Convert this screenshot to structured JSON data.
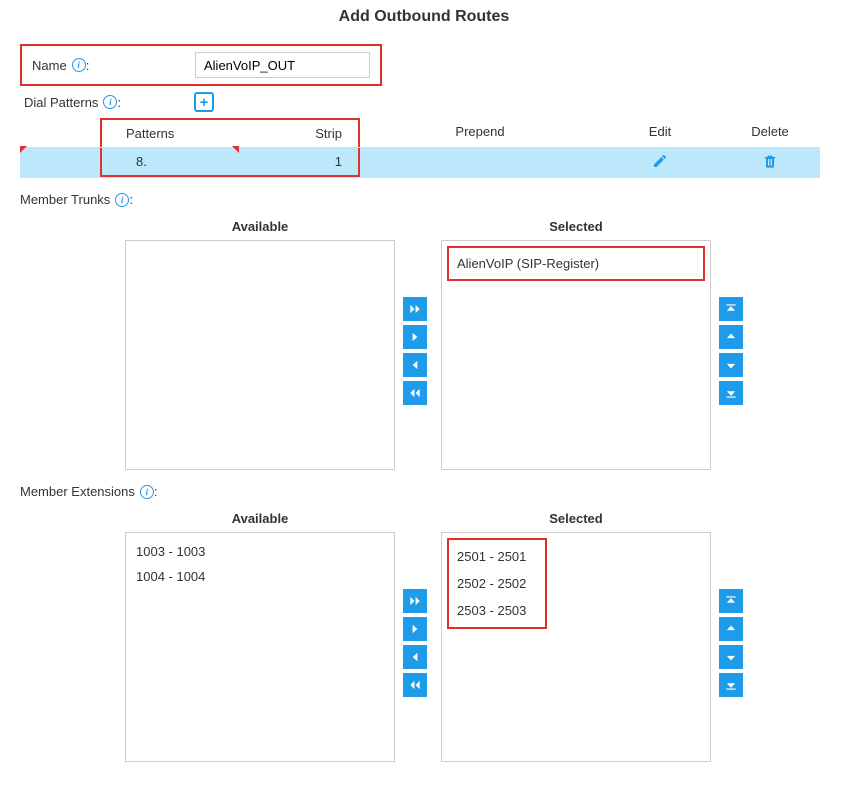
{
  "title": "Add Outbound Routes",
  "name_field": {
    "label": "Name",
    "value": "AlienVoIP_OUT"
  },
  "dial_patterns": {
    "label": "Dial Patterns",
    "headers": {
      "patterns": "Patterns",
      "strip": "Strip",
      "prepend": "Prepend",
      "edit": "Edit",
      "delete": "Delete"
    },
    "rows": [
      {
        "pattern": "8.",
        "strip": "1",
        "prepend": ""
      }
    ]
  },
  "member_trunks": {
    "label": "Member Trunks",
    "available_header": "Available",
    "selected_header": "Selected",
    "available": [],
    "selected": [
      "AlienVoIP (SIP-Register)"
    ]
  },
  "member_extensions": {
    "label": "Member Extensions",
    "available_header": "Available",
    "selected_header": "Selected",
    "available": [
      "1003 - 1003",
      "1004 - 1004"
    ],
    "selected": [
      "2501 - 2501",
      "2502 - 2502",
      "2503 - 2503"
    ]
  }
}
